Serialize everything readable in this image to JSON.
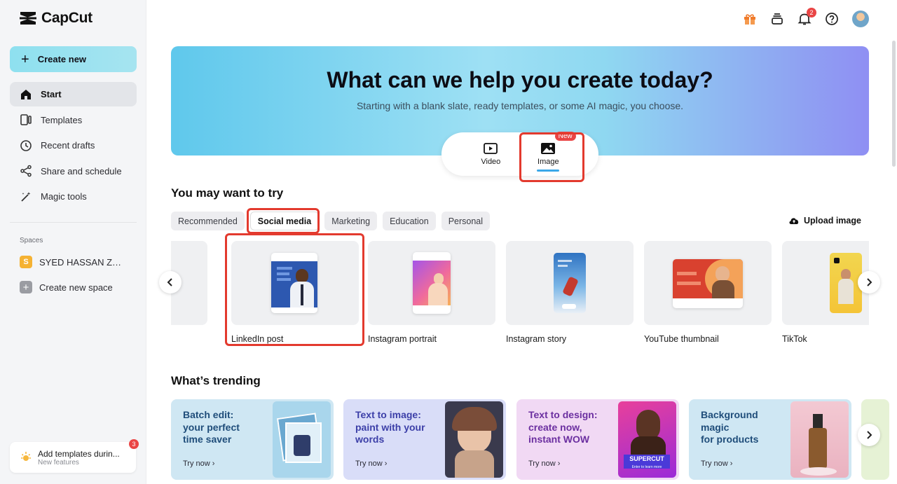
{
  "app": {
    "name": "CapCut"
  },
  "sidebar": {
    "create_label": "Create new",
    "items": [
      {
        "label": "Start",
        "icon": "home-icon",
        "active": true
      },
      {
        "label": "Templates",
        "icon": "templates-icon"
      },
      {
        "label": "Recent drafts",
        "icon": "clock-icon"
      },
      {
        "label": "Share and schedule",
        "icon": "share-icon"
      },
      {
        "label": "Magic tools",
        "icon": "magic-wand-icon"
      }
    ],
    "spaces_label": "Spaces",
    "space_name": "SYED HASSAN ZAM...",
    "space_initial": "S",
    "create_space_label": "Create new space",
    "promo": {
      "title": "Add templates durin...",
      "subtitle": "New features",
      "badge": "3"
    }
  },
  "topbar": {
    "notification_count": "2"
  },
  "hero": {
    "title": "What can we help you create today?",
    "subtitle": "Starting with a blank slate, ready templates, or some AI magic, you choose.",
    "modes": [
      {
        "label": "Video"
      },
      {
        "label": "Image",
        "badge": "New",
        "selected": true
      }
    ]
  },
  "try_section": {
    "title": "You may want to try",
    "chips": [
      "Recommended",
      "Social media",
      "Marketing",
      "Education",
      "Personal"
    ],
    "active_chip": "Social media",
    "upload_label": "Upload image",
    "cards": [
      "LinkedIn post",
      "Instagram portrait",
      "Instagram story",
      "YouTube thumbnail",
      "TikTok"
    ]
  },
  "trending": {
    "title": "What’s trending",
    "cards": [
      {
        "title_lines": [
          "Batch edit:",
          "your perfect",
          "time saver"
        ],
        "cta": "Try now",
        "color": "#1f4d7a"
      },
      {
        "title_lines": [
          "Text to image:",
          "paint with your",
          "words"
        ],
        "cta": "Try now",
        "color": "#3c3fa8"
      },
      {
        "title_lines": [
          "Text to design:",
          "create now,",
          "instant WOW"
        ],
        "cta": "Try now",
        "color": "#6b2fa0"
      },
      {
        "title_lines": [
          "Background",
          "magic",
          "for products"
        ],
        "cta": "Try now",
        "color": "#1f4d7a"
      }
    ],
    "supercut_label": "SUPERCUT",
    "supercut_sub": "Enter to learn more"
  }
}
